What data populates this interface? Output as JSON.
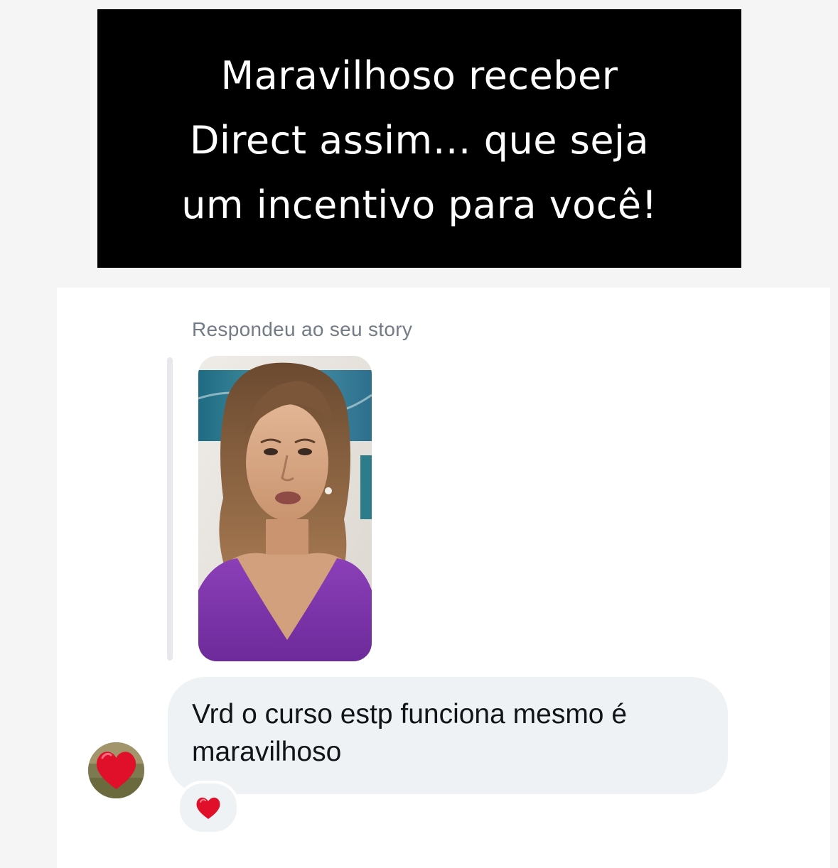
{
  "headline": {
    "lines": [
      "Maravilhoso receber",
      "Direct assim… que seja",
      "um incentivo para você!"
    ]
  },
  "dm": {
    "reply_label": "Respondeu ao seu story",
    "story_preview": {
      "description_icon": "story-video-thumbnail"
    },
    "message": {
      "text": "Vrd o curso estp funciona mesmo é maravilhoso"
    },
    "sender_avatar_icon": "heart-avatar-icon",
    "reaction_icon": "heart-reaction-icon"
  },
  "colors": {
    "headline_bg": "#000000",
    "headline_text": "#ffffff",
    "bubble_bg": "#eff2f5",
    "label_text": "#737b86",
    "heart": "#e0102a"
  }
}
